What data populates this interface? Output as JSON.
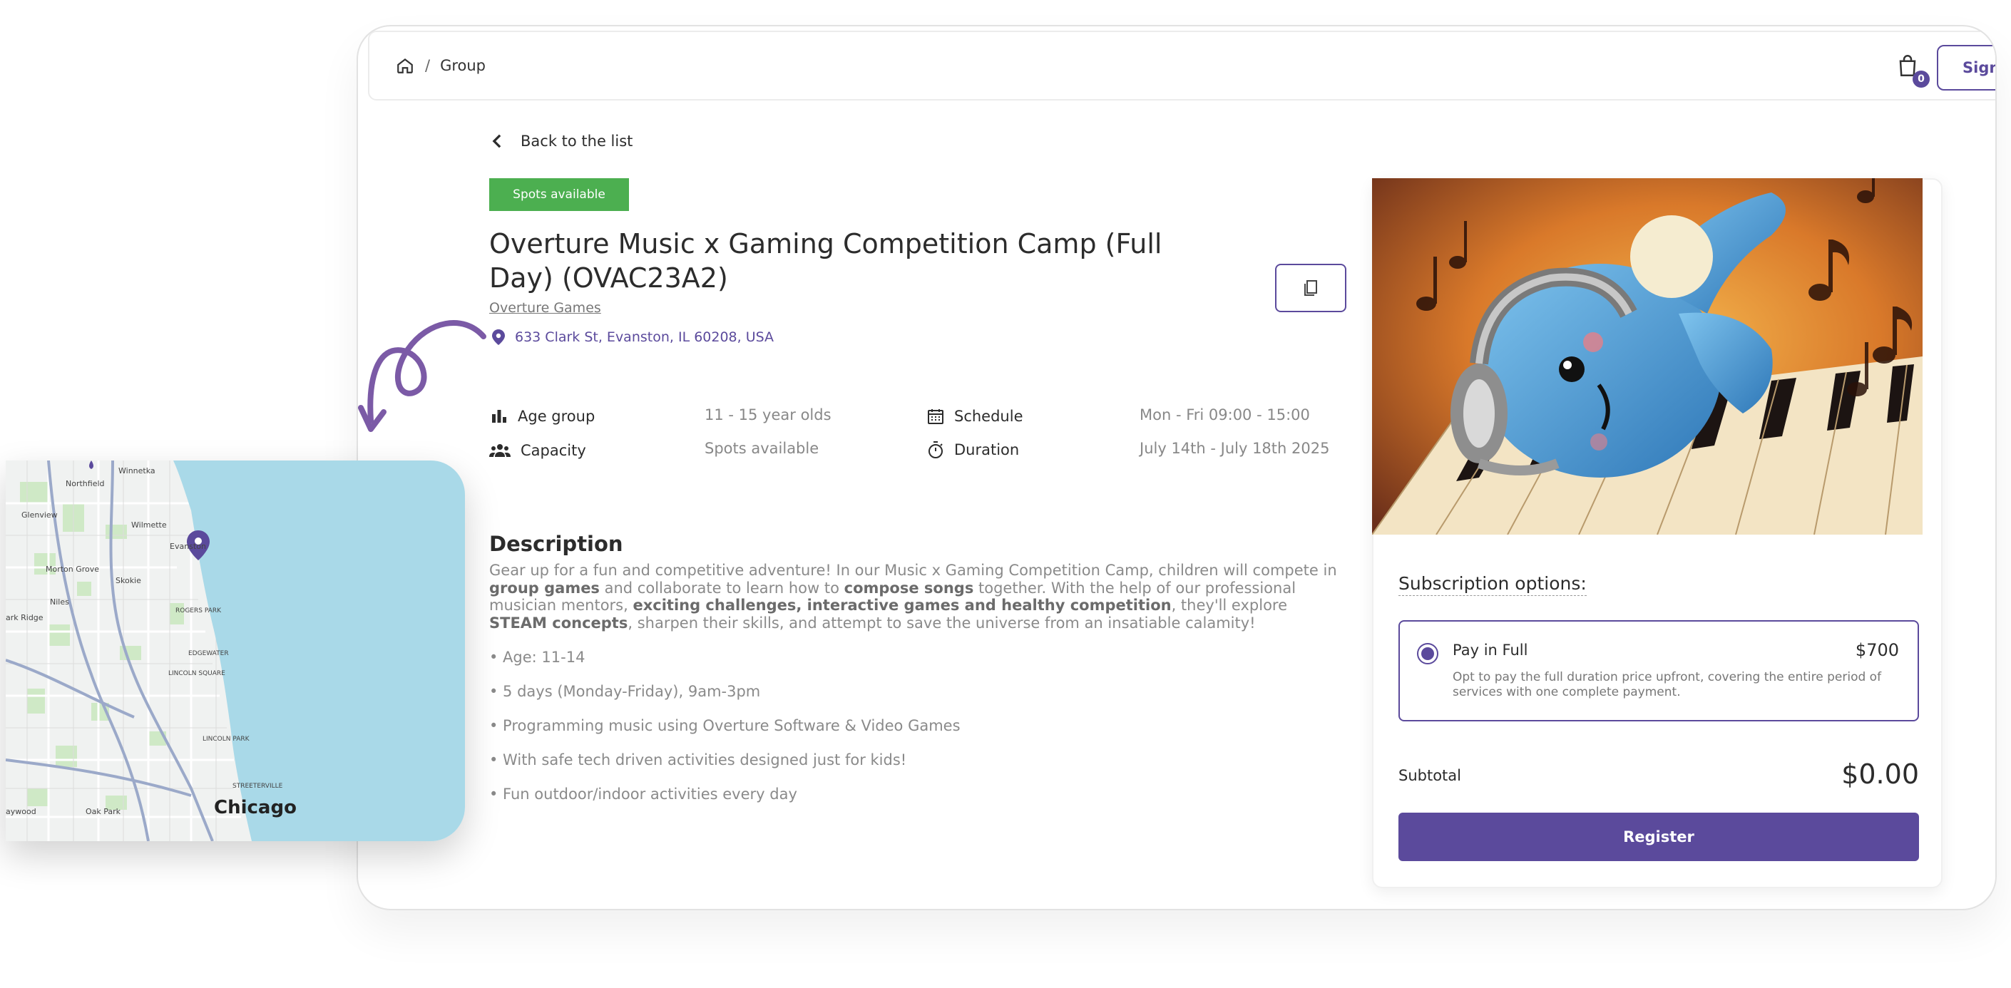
{
  "breadcrumb": {
    "home_icon": "home-icon",
    "separator": "/",
    "current": "Group"
  },
  "header": {
    "cart_count": "0",
    "sign_in_label": "Sign"
  },
  "back": {
    "label": "Back to the list"
  },
  "status_badge": "Spots available",
  "event": {
    "title": "Overture Music x Gaming Competition Camp (Full Day) (OVAC23A2)",
    "organizer": "Overture Games",
    "address": "633 Clark St, Evanston, IL 60208, USA"
  },
  "info": {
    "age_group_label": "Age group",
    "age_group_value": "11 - 15 year olds",
    "capacity_label": "Capacity",
    "capacity_value": "Spots available",
    "schedule_label": "Schedule",
    "schedule_value": "Mon - Fri 09:00 - 15:00",
    "duration_label": "Duration",
    "duration_value": "July 14th - July 18th 2025"
  },
  "description": {
    "heading": "Description",
    "p1_a": "Gear up for a fun and competitive adventure! In our Music x Gaming Competition Camp, children will compete in ",
    "p1_b": "group games",
    "p1_c": " and collaborate to learn how to ",
    "p1_d": "compose songs",
    "p1_e": " together. With the help of our professional musician mentors, ",
    "p1_f": "exciting challenges, interactive games and healthy competition",
    "p1_g": ", they'll explore ",
    "p1_h": "STEAM concepts",
    "p1_i": ", sharpen their skills, and attempt to save the universe from an insatiable calamity!",
    "bullets": [
      "• Age: 11-14",
      "• 5 days (Monday-Friday), 9am-3pm",
      "• Programming music using Overture Software & Video Games",
      "• With safe tech driven activities designed just for kids!",
      "• Fun outdoor/indoor activities every day"
    ]
  },
  "subscription": {
    "heading": "Subscription options:",
    "option_name": "Pay in Full",
    "option_price": "$700",
    "option_desc": "Opt to pay the full duration price upfront, covering the entire period of services with one complete payment."
  },
  "subtotal": {
    "label": "Subtotal",
    "value": "$0.00"
  },
  "register_label": "Register",
  "map": {
    "city": "Chicago",
    "labels": [
      "Northfield",
      "Winnetka",
      "Glenview",
      "Wilmette",
      "Morton Grove",
      "Skokie",
      "Evanston",
      "Niles",
      "ROGERS PARK",
      "EDGEWATER",
      "LINCOLN SQUARE",
      "LINCOLN PARK",
      "STREETERVILLE",
      "Oak Park",
      "Ridge",
      "aywood",
      "ark Ridge"
    ]
  },
  "colors": {
    "accent": "#5b4a9c",
    "badge_green": "#4caf50",
    "lake": "#a9d9e8"
  }
}
